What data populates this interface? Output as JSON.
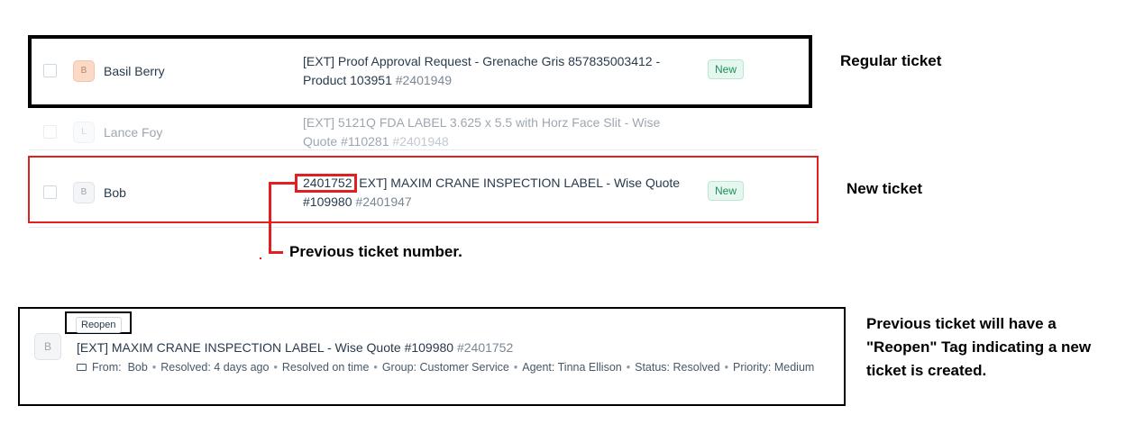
{
  "tickets": [
    {
      "requester": "Basil Berry",
      "initial": "B",
      "subject": "[EXT] Proof Approval Request - Grenache Gris 857835003412 - Product 103951",
      "ticket_id": "#2401949",
      "status": "New"
    },
    {
      "requester": "Lance Foy",
      "initial": "L",
      "subject": "[EXT] 5121Q FDA LABEL 3.625 x 5.5 with Horz Face Slit - Wise Quote #110281",
      "ticket_id": "#2401948",
      "status": ""
    },
    {
      "requester": "Bob",
      "initial": "B",
      "subject_prefix": "2401752",
      "subject": "EXT] MAXIM CRANE INSPECTION LABEL - Wise Quote #109980",
      "ticket_id": "#2401947",
      "status": "New"
    }
  ],
  "annotations": {
    "regular": "Regular ticket",
    "new": "New ticket",
    "previous_number": "Previous ticket number.",
    "reopen_note": "Previous ticket will have a \"Reopen\" Tag indicating a new ticket is created."
  },
  "reopened_ticket": {
    "tag": "Reopen",
    "initial": "B",
    "subject": "[EXT] MAXIM CRANE INSPECTION LABEL - Wise Quote #109980",
    "ticket_id": "#2401752",
    "meta": {
      "from_label": "From:",
      "from": "Bob",
      "resolved": "Resolved: 4 days ago",
      "resolved_on_time": "Resolved on time",
      "group": "Group: Customer Service",
      "agent": "Agent: Tinna Ellison",
      "status": "Status: Resolved",
      "priority": "Priority: Medium"
    }
  },
  "colors": {
    "new_badge": "#1e8f5a",
    "annotation_red": "#e02020"
  }
}
